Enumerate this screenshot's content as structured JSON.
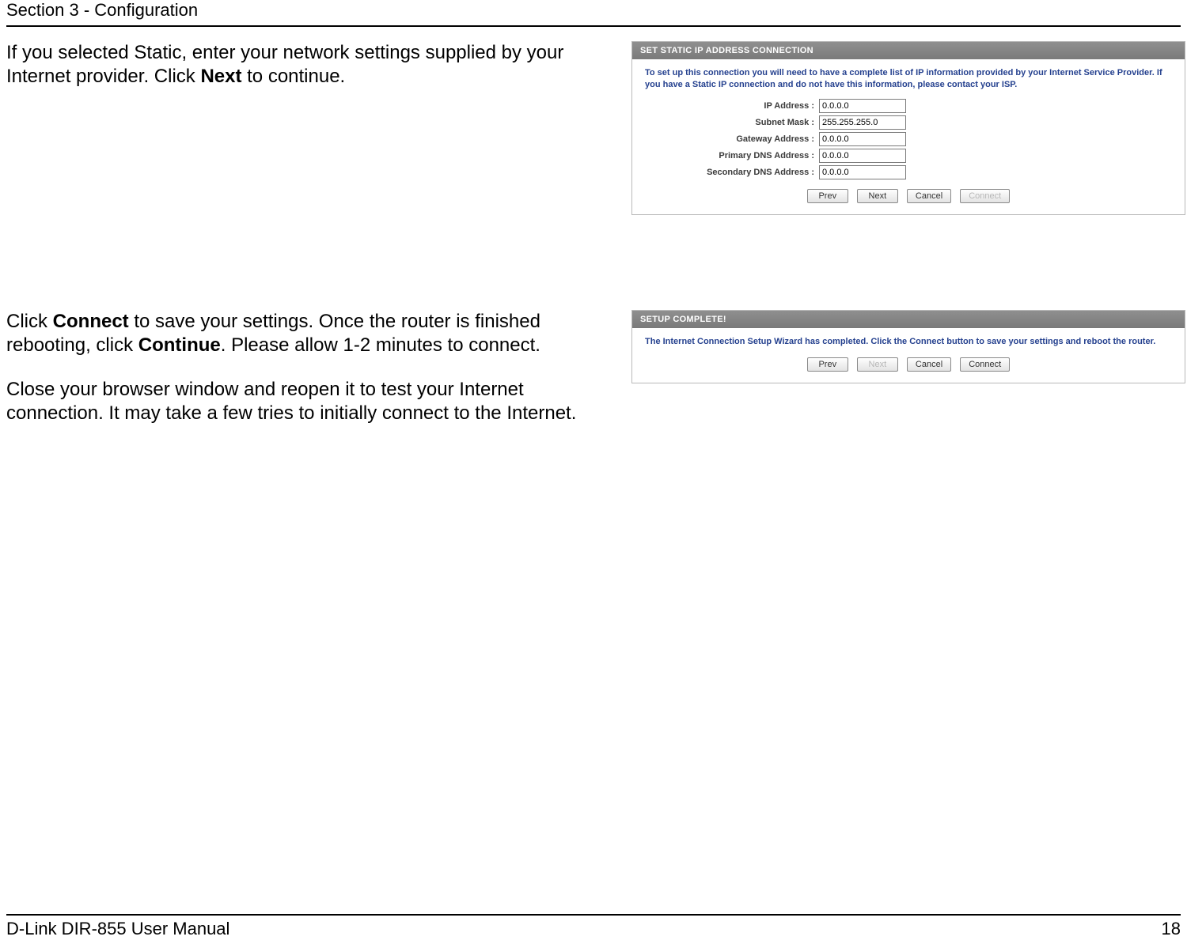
{
  "header": {
    "section": "Section 3 - Configuration"
  },
  "block1": {
    "text_pre": "If you selected Static, enter your network settings supplied by your Internet provider. Click ",
    "text_bold": "Next",
    "text_post": " to continue.",
    "dialog": {
      "title": "SET STATIC IP ADDRESS CONNECTION",
      "blurb": "To set up this connection you will need to have a complete list of IP information provided by your Internet Service Provider. If you have a Static IP connection and do not have this information, please contact your ISP.",
      "fields": {
        "ip_label": "IP Address :",
        "ip_value": "0.0.0.0",
        "mask_label": "Subnet Mask :",
        "mask_value": "255.255.255.0",
        "gw_label": "Gateway Address :",
        "gw_value": "0.0.0.0",
        "dns1_label": "Primary DNS Address :",
        "dns1_value": "0.0.0.0",
        "dns2_label": "Secondary DNS Address :",
        "dns2_value": "0.0.0.0"
      },
      "buttons": {
        "prev": "Prev",
        "next": "Next",
        "cancel": "Cancel",
        "connect": "Connect"
      }
    }
  },
  "block2": {
    "p1_pre": "Click ",
    "p1_b1": "Connect",
    "p1_mid": " to save your settings. Once the router is finished rebooting, click ",
    "p1_b2": "Continue",
    "p1_post": ". Please allow 1-2 minutes to connect.",
    "p2": "Close your browser window and reopen it to test your Internet connection. It may take a few tries to initially connect to the Internet.",
    "dialog": {
      "title": "SETUP COMPLETE!",
      "blurb": "The Internet Connection Setup Wizard has completed. Click the Connect button to save your settings and reboot the router.",
      "buttons": {
        "prev": "Prev",
        "next": "Next",
        "cancel": "Cancel",
        "connect": "Connect"
      }
    }
  },
  "footer": {
    "left": "D-Link DIR-855 User Manual",
    "right": "18"
  }
}
